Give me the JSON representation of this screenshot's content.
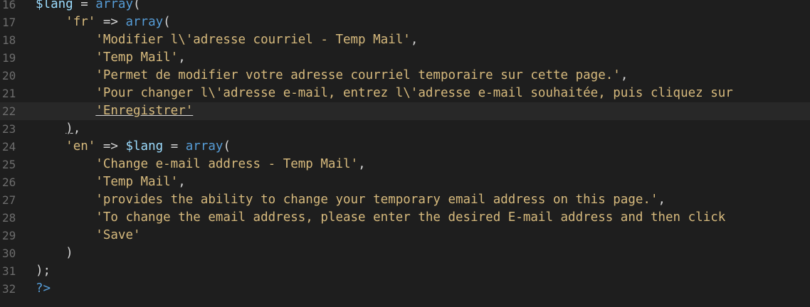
{
  "editor": {
    "lines": [
      {
        "n": "16",
        "tokens": [
          {
            "t": "$lang",
            "c": "var"
          },
          {
            "t": " = ",
            "c": "op"
          },
          {
            "t": "array",
            "c": "kw"
          },
          {
            "t": "(",
            "c": "pu"
          }
        ]
      },
      {
        "n": "17",
        "tokens": [
          {
            "t": "    ",
            "c": "op"
          },
          {
            "t": "'fr'",
            "c": "strg"
          },
          {
            "t": " => ",
            "c": "op"
          },
          {
            "t": "array",
            "c": "kw"
          },
          {
            "t": "(",
            "c": "pu"
          }
        ]
      },
      {
        "n": "18",
        "tokens": [
          {
            "t": "        ",
            "c": "op"
          },
          {
            "t": "'Modifier l\\'adresse courriel - Temp Mail'",
            "c": "strg"
          },
          {
            "t": ",",
            "c": "pu"
          }
        ]
      },
      {
        "n": "19",
        "tokens": [
          {
            "t": "        ",
            "c": "op"
          },
          {
            "t": "'Temp Mail'",
            "c": "strg"
          },
          {
            "t": ",",
            "c": "pu"
          }
        ]
      },
      {
        "n": "20",
        "tokens": [
          {
            "t": "        ",
            "c": "op"
          },
          {
            "t": "'Permet de modifier votre adresse courriel temporaire sur cette page.'",
            "c": "strg"
          },
          {
            "t": ",",
            "c": "pu"
          }
        ]
      },
      {
        "n": "21",
        "tokens": [
          {
            "t": "        ",
            "c": "op"
          },
          {
            "t": "'Pour changer l\\'adresse e-mail, entrez l\\'adresse e-mail souhaitée, puis cliquez sur",
            "c": "strg"
          }
        ]
      },
      {
        "n": "22",
        "current": true,
        "tokens": [
          {
            "t": "        ",
            "c": "op"
          },
          {
            "t": "'Enregistrer'",
            "c": "strg",
            "u": true
          }
        ]
      },
      {
        "n": "23",
        "tokens": [
          {
            "t": "    ",
            "c": "op"
          },
          {
            "t": ")",
            "c": "pu",
            "u": true
          },
          {
            "t": ",",
            "c": "pu"
          }
        ]
      },
      {
        "n": "24",
        "tokens": [
          {
            "t": "    ",
            "c": "op"
          },
          {
            "t": "'en'",
            "c": "strg"
          },
          {
            "t": " => ",
            "c": "op"
          },
          {
            "t": "$lang",
            "c": "var"
          },
          {
            "t": " = ",
            "c": "op"
          },
          {
            "t": "array",
            "c": "kw"
          },
          {
            "t": "(",
            "c": "pu"
          }
        ]
      },
      {
        "n": "25",
        "tokens": [
          {
            "t": "        ",
            "c": "op"
          },
          {
            "t": "'Change e-mail address - Temp Mail'",
            "c": "strg"
          },
          {
            "t": ",",
            "c": "pu"
          }
        ]
      },
      {
        "n": "26",
        "tokens": [
          {
            "t": "        ",
            "c": "op"
          },
          {
            "t": "'Temp Mail'",
            "c": "strg"
          },
          {
            "t": ",",
            "c": "pu"
          }
        ]
      },
      {
        "n": "27",
        "tokens": [
          {
            "t": "        ",
            "c": "op"
          },
          {
            "t": "'provides the ability to change your temporary email address on this page.'",
            "c": "strg"
          },
          {
            "t": ",",
            "c": "pu"
          }
        ]
      },
      {
        "n": "28",
        "tokens": [
          {
            "t": "        ",
            "c": "op"
          },
          {
            "t": "'To change the email address, please enter the desired E-mail address and then click",
            "c": "strg"
          }
        ]
      },
      {
        "n": "29",
        "tokens": [
          {
            "t": "        ",
            "c": "op"
          },
          {
            "t": "'Save'",
            "c": "strg"
          }
        ]
      },
      {
        "n": "30",
        "tokens": [
          {
            "t": "    ",
            "c": "op"
          },
          {
            "t": ")",
            "c": "pu"
          }
        ]
      },
      {
        "n": "31",
        "tokens": [
          {
            "t": ");",
            "c": "pu"
          }
        ]
      },
      {
        "n": "32",
        "tokens": [
          {
            "t": "?>",
            "c": "php"
          }
        ]
      }
    ]
  },
  "colors": {
    "background": "#1e1e1e",
    "current_line": "#282828",
    "line_number": "#6d6d6d",
    "variable": "#9cdcfe",
    "keyword": "#569cd6",
    "string": "#d7ba7d",
    "punctuation": "#d4d4d4"
  }
}
